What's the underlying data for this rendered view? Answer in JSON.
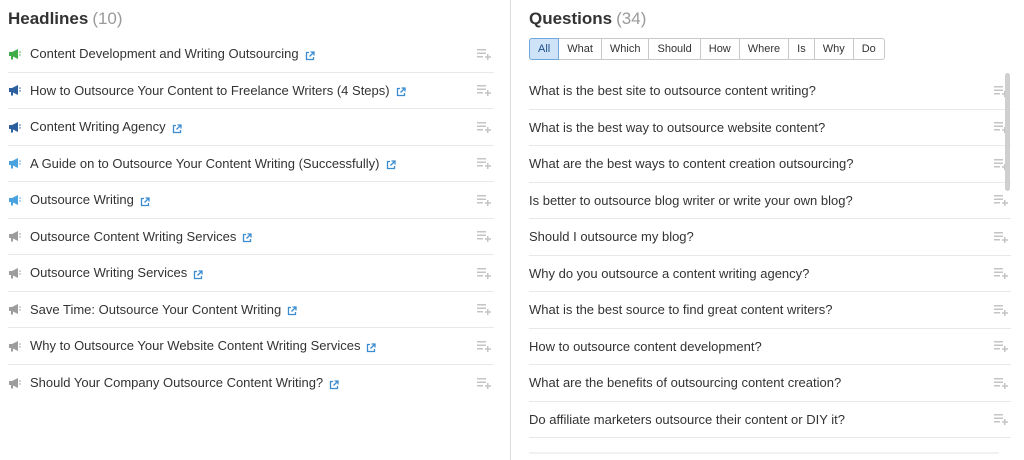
{
  "headlines": {
    "title": "Headlines",
    "count": "(10)",
    "items": [
      {
        "text": "Content Development and Writing Outsourcing",
        "icon": "megaphone-green-icon"
      },
      {
        "text": "How to Outsource Your Content to Freelance Writers (4 Steps)",
        "icon": "megaphone-dark-blue-icon"
      },
      {
        "text": "Content Writing Agency",
        "icon": "megaphone-dark-blue-icon"
      },
      {
        "text": "A Guide on to Outsource Your Content Writing (Successfully)",
        "icon": "megaphone-light-blue-icon"
      },
      {
        "text": "Outsource Writing",
        "icon": "megaphone-light-blue-icon"
      },
      {
        "text": "Outsource Content Writing Services",
        "icon": "megaphone-gray-icon"
      },
      {
        "text": "Outsource Writing Services",
        "icon": "megaphone-gray-icon"
      },
      {
        "text": "Save Time: Outsource Your Content Writing",
        "icon": "megaphone-gray-icon"
      },
      {
        "text": "Why to Outsource Your Website Content Writing Services",
        "icon": "megaphone-gray-icon"
      },
      {
        "text": "Should Your Company Outsource Content Writing?",
        "icon": "megaphone-gray-icon"
      }
    ]
  },
  "questions": {
    "title": "Questions",
    "count": "(34)",
    "filters": [
      "All",
      "What",
      "Which",
      "Should",
      "How",
      "Where",
      "Is",
      "Why",
      "Do"
    ],
    "active_filter": "All",
    "items": [
      "What is the best site to outsource content writing?",
      "What is the best way to outsource website content?",
      "What are the best ways to content creation outsourcing?",
      "Is better to outsource blog writer or write your own blog?",
      "Should I outsource my blog?",
      "Why do you outsource a content writing agency?",
      "What is the best source to find great content writers?",
      "How to outsource content development?",
      "What are the benefits of outsourcing content creation?",
      "Do affiliate marketers outsource their content or DIY it?"
    ]
  },
  "colors": {
    "green": "#3fae49",
    "dark_blue": "#2c5f9e",
    "light_blue": "#4aa3df",
    "gray": "#9d9d9d",
    "link": "#3b8bd1",
    "active_filter_bg": "#cfe3f8"
  }
}
